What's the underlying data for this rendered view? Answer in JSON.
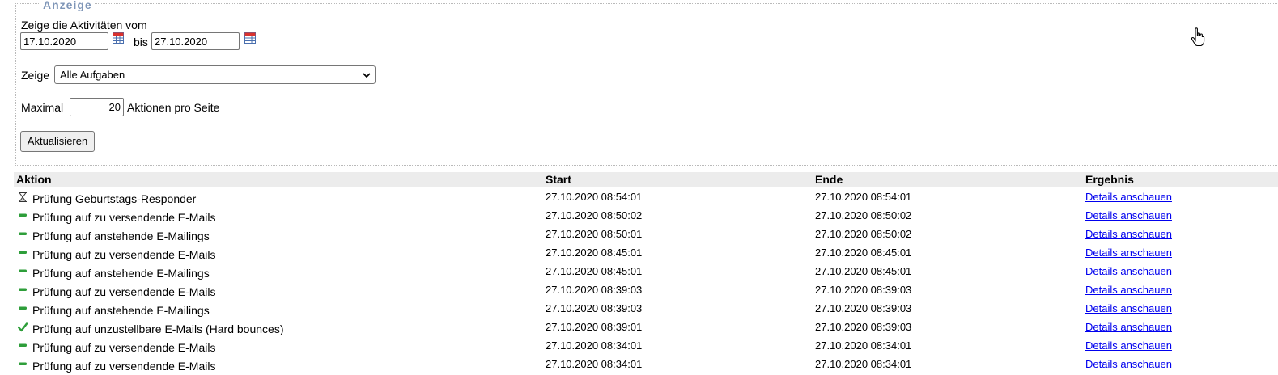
{
  "filter": {
    "legend": "Anzeige",
    "intro_label": "Zeige die Aktivitäten vom",
    "date_from": "17.10.2020",
    "to_label": "bis",
    "date_to": "27.10.2020",
    "show_label": "Zeige",
    "show_selected": "Alle Aufgaben",
    "max_label": "Maximal",
    "max_value": "20",
    "per_page_label": "Aktionen pro Seite",
    "refresh_button": "Aktualisieren"
  },
  "table": {
    "headers": {
      "action": "Aktion",
      "start": "Start",
      "end": "Ende",
      "result": "Ergebnis"
    },
    "rows": [
      {
        "icon": "hourglass-icon",
        "action": "Prüfung Geburtstags-Responder",
        "start": "27.10.2020 08:54:01",
        "end": "27.10.2020 08:54:01",
        "result": "Details anschauen"
      },
      {
        "icon": "dash-icon",
        "action": "Prüfung auf zu versendende E-Mails",
        "start": "27.10.2020 08:50:02",
        "end": "27.10.2020 08:50:02",
        "result": "Details anschauen"
      },
      {
        "icon": "dash-icon",
        "action": "Prüfung auf anstehende E-Mailings",
        "start": "27.10.2020 08:50:01",
        "end": "27.10.2020 08:50:02",
        "result": "Details anschauen"
      },
      {
        "icon": "dash-icon",
        "action": "Prüfung auf zu versendende E-Mails",
        "start": "27.10.2020 08:45:01",
        "end": "27.10.2020 08:45:01",
        "result": "Details anschauen"
      },
      {
        "icon": "dash-icon",
        "action": "Prüfung auf anstehende E-Mailings",
        "start": "27.10.2020 08:45:01",
        "end": "27.10.2020 08:45:01",
        "result": "Details anschauen"
      },
      {
        "icon": "dash-icon",
        "action": "Prüfung auf zu versendende E-Mails",
        "start": "27.10.2020 08:39:03",
        "end": "27.10.2020 08:39:03",
        "result": "Details anschauen"
      },
      {
        "icon": "dash-icon",
        "action": "Prüfung auf anstehende E-Mailings",
        "start": "27.10.2020 08:39:03",
        "end": "27.10.2020 08:39:03",
        "result": "Details anschauen"
      },
      {
        "icon": "check-icon",
        "action": "Prüfung auf unzustellbare E-Mails (Hard bounces)",
        "start": "27.10.2020 08:39:01",
        "end": "27.10.2020 08:39:03",
        "result": "Details anschauen"
      },
      {
        "icon": "dash-icon",
        "action": "Prüfung auf zu versendende E-Mails",
        "start": "27.10.2020 08:34:01",
        "end": "27.10.2020 08:34:01",
        "result": "Details anschauen"
      },
      {
        "icon": "dash-icon",
        "action": "Prüfung auf zu versendende E-Mails",
        "start": "27.10.2020 08:34:01",
        "end": "27.10.2020 08:34:01",
        "result": "Details anschauen"
      }
    ]
  },
  "colors": {
    "legend": "#7e95b7",
    "link": "#0000ee",
    "ok_green": "#2e9e3a",
    "header_bg": "#ececec"
  }
}
